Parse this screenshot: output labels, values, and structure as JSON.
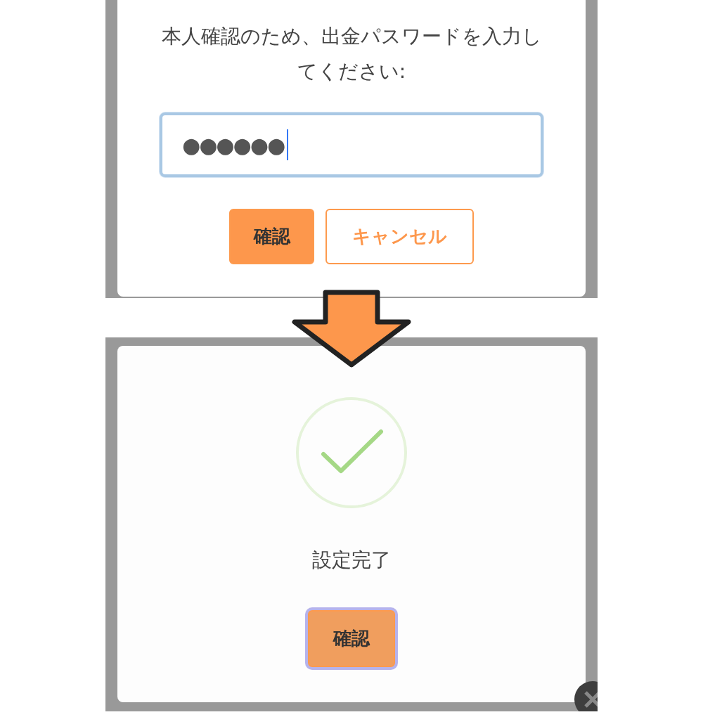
{
  "password_dialog": {
    "message": "本人確認のため、出金パスワードを入力してください:",
    "password_field": {
      "value": "●●●●●●",
      "focused": true
    },
    "buttons": [
      {
        "label": "確認",
        "kind": "primary",
        "focused": false
      },
      {
        "label": "キャンセル",
        "kind": "outline",
        "focused": false
      }
    ]
  },
  "success_dialog": {
    "message": "設定完了",
    "buttons": [
      {
        "label": "確認",
        "kind": "primary",
        "focused": true
      }
    ]
  }
}
